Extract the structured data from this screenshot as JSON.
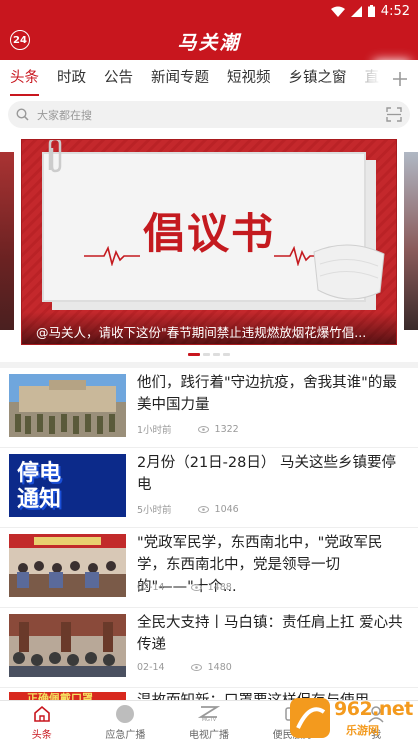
{
  "status_bar": {
    "time": "4:52",
    "icons": [
      "wifi-icon",
      "signal-icon",
      "battery-icon"
    ]
  },
  "header": {
    "badge": "24",
    "brand": "马关潮"
  },
  "tabs": [
    {
      "label": "头条",
      "active": true
    },
    {
      "label": "时政"
    },
    {
      "label": "公告"
    },
    {
      "label": "新闻专题"
    },
    {
      "label": "短视频"
    },
    {
      "label": "乡镇之窗"
    },
    {
      "label": "直"
    }
  ],
  "search": {
    "placeholder": "大家都在搜"
  },
  "carousel": {
    "image_text": "倡议书",
    "caption": "@马关人，请收下这份\"春节期间禁止违规燃放烟花爆竹倡...",
    "dots_total": 4,
    "dots_active": 0
  },
  "news": [
    {
      "title": "他们，践行着\"守边抗疫，舍我其谁\"的最美中国力量",
      "time": "1小时前",
      "views": "1322"
    },
    {
      "title": "2月份（21日-28日） 马关这些乡镇要停电",
      "time": "5小时前",
      "views": "1046",
      "thumb_text_1": "停电",
      "thumb_text_2": "通知"
    },
    {
      "title": "\"党政军民学，东西南北中，\"党政军民学，东西南北中，党是领导一切的\"——\"十个...",
      "time": "02-14",
      "views": "1488"
    },
    {
      "title": "全民大支持丨马白镇：责任肩上扛 爱心共传递",
      "time": "02-14",
      "views": "1480"
    },
    {
      "title": "温故而知新：口罩要这样保存与使用",
      "thumb_text": "正确佩戴口罩"
    }
  ],
  "bottom_nav": [
    {
      "label": "头条",
      "icon": "home-icon",
      "active": true
    },
    {
      "label": "应急广播",
      "icon": "broadcast-icon"
    },
    {
      "label": "电视广播",
      "icon": "tv-icon",
      "icon_text": "MGTV"
    },
    {
      "label": "便民服务",
      "icon": "service-icon"
    },
    {
      "label": "我",
      "icon": "user-icon"
    }
  ],
  "watermark": {
    "brand": "962.net",
    "sub": "乐游网"
  },
  "colors": {
    "brand_red": "#c8161e"
  }
}
